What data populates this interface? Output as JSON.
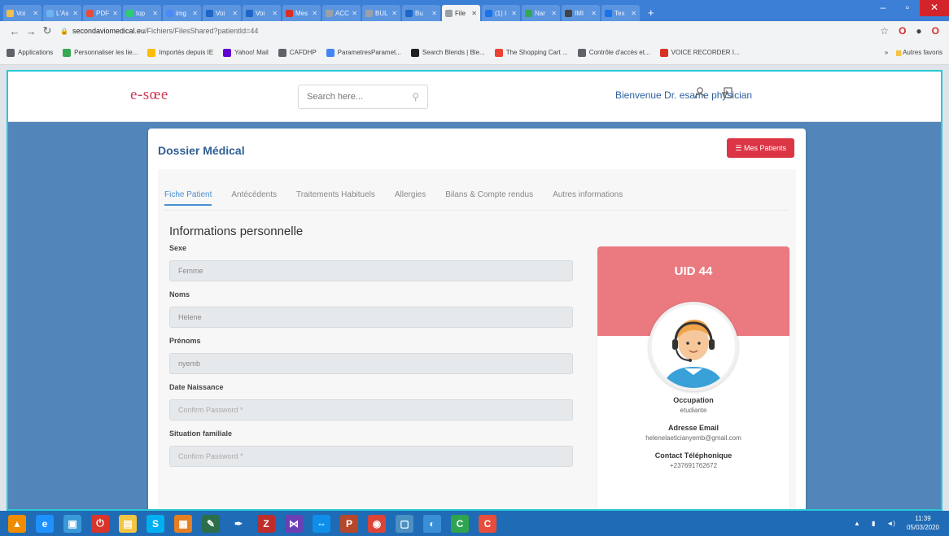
{
  "browser": {
    "tabs": [
      {
        "label": "Voi",
        "color": "#f0c04c"
      },
      {
        "label": "L'As",
        "color": "#6db3f2"
      },
      {
        "label": "PDF",
        "color": "#e74c3c"
      },
      {
        "label": "top",
        "color": "#2ecc71"
      },
      {
        "label": "img",
        "color": "#4c8bf5"
      },
      {
        "label": "Voi",
        "color": "#1e66c8"
      },
      {
        "label": "Voi",
        "color": "#1e66c8"
      },
      {
        "label": "Mes",
        "color": "#d93025"
      },
      {
        "label": "ACC",
        "color": "#9aa0a6"
      },
      {
        "label": "BUL",
        "color": "#9aa0a6"
      },
      {
        "label": "Bu",
        "color": "#1e66c8"
      },
      {
        "label": "File",
        "color": "#9aa0a6",
        "active": true
      },
      {
        "label": "(1) I",
        "color": "#1a73e8"
      },
      {
        "label": "Nar",
        "color": "#34a853"
      },
      {
        "label": "IMI",
        "color": "#444444"
      },
      {
        "label": "Tex",
        "color": "#1a73e8"
      }
    ],
    "new_tab_glyph": "+",
    "window_controls": {
      "minimize": "–",
      "maximize": "▫",
      "close": "✕"
    },
    "url_domain": "secondaviomedical.eu",
    "url_path": "/Fichiers/FilesShared?patientId=44",
    "bookmarks": [
      {
        "label": "Applications",
        "color": "#5f6368"
      },
      {
        "label": "Personnaliser les lie...",
        "color": "#34a853"
      },
      {
        "label": "Importés depuis IE",
        "color": "#fbbc04"
      },
      {
        "label": "Yahoo! Mail",
        "color": "#6001d2"
      },
      {
        "label": "CAFDHP",
        "color": "#5f6368"
      },
      {
        "label": "ParametresParamet...",
        "color": "#4285f4"
      },
      {
        "label": "Search Blends | Ble...",
        "color": "#202124"
      },
      {
        "label": "The Shopping Cart ...",
        "color": "#ea4335"
      },
      {
        "label": "Contrôle d'accès et...",
        "color": "#5f6368"
      },
      {
        "label": "VOICE RECORDER I...",
        "color": "#d93025"
      }
    ],
    "bookmark_more": "»",
    "bookmark_other": "Autres favoris"
  },
  "site": {
    "logo": "e-sœe",
    "search_placeholder": "Search here...",
    "welcome": "Bienvenue Dr. esame physician"
  },
  "card": {
    "title": "Dossier Médical",
    "mes_patients": "☰ Mes Patients",
    "tabs": [
      {
        "label": "Fiche Patient",
        "active": true
      },
      {
        "label": "Antécédents"
      },
      {
        "label": "Traitements Habituels"
      },
      {
        "label": "Allergies"
      },
      {
        "label": "Bilans & Compte rendus"
      },
      {
        "label": "Autres informations"
      }
    ],
    "section_title": "Informations personnelle",
    "fields": [
      {
        "label": "Sexe",
        "value": "Femme",
        "placeholder": ""
      },
      {
        "label": "Noms",
        "value": "Helene",
        "placeholder": ""
      },
      {
        "label": "Prénoms",
        "value": "nyemb",
        "placeholder": ""
      },
      {
        "label": "Date Naissance",
        "value": "",
        "placeholder": "Confirm Password *"
      },
      {
        "label": "Situation familiale",
        "value": "",
        "placeholder": "Confirm Password *"
      }
    ],
    "profile": {
      "uid": "UID 44",
      "occupation_label": "Occupation",
      "occupation": "etudiante",
      "email_label": "Adresse Email",
      "email": "helenelaeticianyemb@gmail.com",
      "phone_label": "Contact Téléphonique",
      "phone": "+237691762672"
    }
  },
  "taskbar": {
    "icons": [
      {
        "name": "vlc-icon",
        "glyph": "▲",
        "color": "#f08c00"
      },
      {
        "name": "internet-explorer-icon",
        "glyph": "e",
        "color": "#1e90ff"
      },
      {
        "name": "desktop-icon",
        "glyph": "▣",
        "color": "#3a9ad9"
      },
      {
        "name": "power-icon",
        "glyph": "⏻",
        "color": "#d9342b"
      },
      {
        "name": "folder-icon",
        "glyph": "▤",
        "color": "#f4c542"
      },
      {
        "name": "skype-icon",
        "glyph": "S",
        "color": "#00aff0"
      },
      {
        "name": "calendar-icon",
        "glyph": "▦",
        "color": "#e67e22"
      },
      {
        "name": "pen-icon",
        "glyph": "✎",
        "color": "#2c6e49"
      },
      {
        "name": "quill-icon",
        "glyph": "✒",
        "color": "#1f6bb5"
      },
      {
        "name": "filezilla-icon",
        "glyph": "Z",
        "color": "#bf2c2c"
      },
      {
        "name": "visual-studio-icon",
        "glyph": "⋈",
        "color": "#6c3fb5"
      },
      {
        "name": "teamviewer-icon",
        "glyph": "⇔",
        "color": "#0e8ee9"
      },
      {
        "name": "publisher-icon",
        "glyph": "P",
        "color": "#b7472a"
      },
      {
        "name": "chrome-icon",
        "glyph": "◉",
        "color": "#db4437"
      },
      {
        "name": "window-icon",
        "glyph": "▢",
        "color": "#4a90c2"
      },
      {
        "name": "edge-icon",
        "glyph": "◐",
        "color": "#3a8fd6"
      },
      {
        "name": "camtasia-icon",
        "glyph": "C",
        "color": "#2ea44f"
      },
      {
        "name": "app-c-icon",
        "glyph": "C",
        "color": "#e74c3c"
      }
    ],
    "time": "11:39",
    "date": "05/03/2020"
  }
}
